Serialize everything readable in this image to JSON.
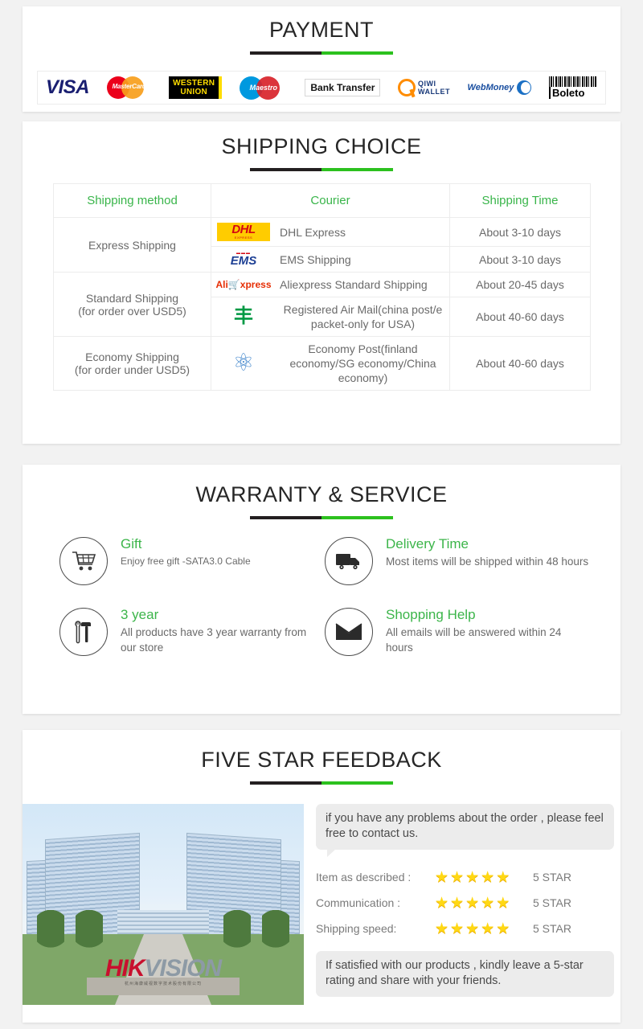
{
  "colors": {
    "accent_green": "#3cb54a",
    "heading_black": "#262626",
    "divider_black": "#231f20",
    "divider_green": "#2cc11e",
    "body_gray": "#6a6a6a",
    "star_yellow": "#ffd814"
  },
  "payment": {
    "title": "PAYMENT",
    "methods": [
      {
        "name": "visa-logo",
        "label": "VISA"
      },
      {
        "name": "mastercard-logo",
        "label": "MasterCard"
      },
      {
        "name": "western-union-logo",
        "line1": "WESTERN",
        "line2": "UNION"
      },
      {
        "name": "maestro-logo",
        "label": "Maestro"
      },
      {
        "name": "bank-transfer-logo",
        "label": "Bank Transfer"
      },
      {
        "name": "qiwi-wallet-logo",
        "line1": "QIWI",
        "line2": "WALLET"
      },
      {
        "name": "webmoney-logo",
        "label": "WebMoney"
      },
      {
        "name": "boleto-logo",
        "label": "Boleto"
      }
    ]
  },
  "shipping": {
    "title": "SHIPPING CHOICE",
    "columns": [
      "Shipping method",
      "Courier",
      "Shipping Time"
    ],
    "rows": [
      {
        "method": "Express Shipping",
        "method_line2": "",
        "rowspan": 2,
        "couriers": [
          {
            "logo": "dhl-logo",
            "logo_text": "DHL",
            "logo_sub": "EXPRESS",
            "name": "DHL Express",
            "time": "About 3-10 days"
          },
          {
            "logo": "ems-logo",
            "logo_text": "EMS",
            "logo_sub": "",
            "name": "EMS Shipping",
            "time": "About 3-10 days"
          }
        ]
      },
      {
        "method": "Standard Shipping",
        "method_line2": "(for order over USD5)",
        "rowspan": 2,
        "couriers": [
          {
            "logo": "aliexpress-logo",
            "logo_text": "Ali",
            "logo_sub": "xpress",
            "name": "Aliexpress Standard Shipping",
            "time": "About 20-45 days"
          },
          {
            "logo": "china-post-logo",
            "logo_text": "",
            "logo_sub": "",
            "name": "Registered Air Mail(china post/e packet-only for USA)",
            "time": "About 40-60 days"
          }
        ]
      },
      {
        "method": "Economy Shipping",
        "method_line2": "(for order under USD5)",
        "rowspan": 1,
        "couriers": [
          {
            "logo": "un-post-logo",
            "logo_text": "",
            "logo_sub": "",
            "name": "Economy Post(finland economy/SG economy/China economy)",
            "time": "About 40-60 days"
          }
        ]
      }
    ]
  },
  "warranty": {
    "title": "WARRANTY & SERVICE",
    "items": [
      {
        "icon": "shopping-cart-icon",
        "title": "Gift",
        "desc": "Enjoy free gift -SATA3.0 Cable"
      },
      {
        "icon": "delivery-truck-icon",
        "title": "Delivery Time",
        "desc": "Most items will be shipped within 48 hours"
      },
      {
        "icon": "wrench-hammer-icon",
        "title": "3 year",
        "desc": "All products have 3 year warranty from our store"
      },
      {
        "icon": "envelope-icon",
        "title": "Shopping Help",
        "desc": "All emails will be answered within 24 hours"
      }
    ]
  },
  "feedback": {
    "title": "FIVE STAR FEEDBACK",
    "photo_caption": "HIKVISION",
    "photo_logo_part1": "HIK",
    "photo_logo_part2": "VISION",
    "photo_base_text": "杭州海康威视数字技术股份有限公司",
    "bubble_top": "if you have any problems about the order , please feel free to contact us.",
    "ratings": [
      {
        "label": "Item as described :",
        "stars": 5,
        "value": "5 STAR"
      },
      {
        "label": "Communication :",
        "stars": 5,
        "value": "5 STAR"
      },
      {
        "label": "Shipping speed:",
        "stars": 5,
        "value": "5 STAR"
      }
    ],
    "bubble_bottom": "If satisfied with our products , kindly leave a 5-star rating and share with your friends.",
    "star_glyph": "★"
  }
}
